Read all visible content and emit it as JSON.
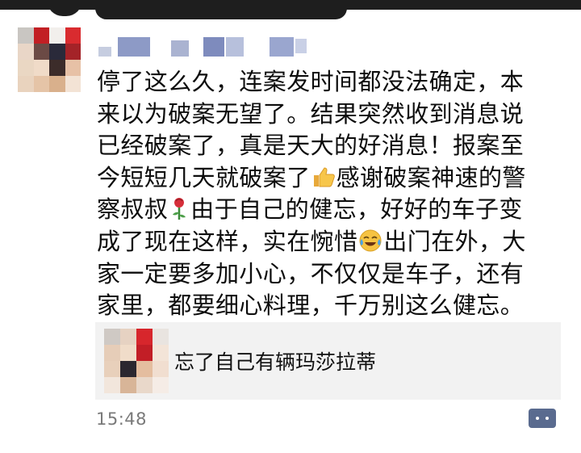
{
  "post": {
    "lines": [
      "停了这么久，连案发时间都没法确定，本",
      "来以为破案无望了。结果突然收到消息说",
      "已经破案了，真是天大的好消息！报案至"
    ],
    "line4_a": "今短短几天就破案了",
    "line4_b": "感谢破案神速的警",
    "line5_a": "察叔叔",
    "line5_b": "由于自己的健忘，好好的车子变",
    "line6_a": "成了现在这样，实在惋惜",
    "line6_b": "出门在外，大",
    "lines_end": [
      "家一定要多加小心，不仅仅是车子，还有",
      "家里，都要细心料理，千万别这么健忘。"
    ],
    "icons": [
      "thumbs-up-icon",
      "rose-icon",
      "crying-laughing-icon"
    ]
  },
  "share": {
    "title": "忘了自己有辆玛莎拉蒂"
  },
  "meta": {
    "timestamp": "15:48"
  },
  "colors": {
    "card_bg": "#f2f2f2",
    "comment_button": "#5a6b8f",
    "timestamp": "#7a7a7a"
  }
}
